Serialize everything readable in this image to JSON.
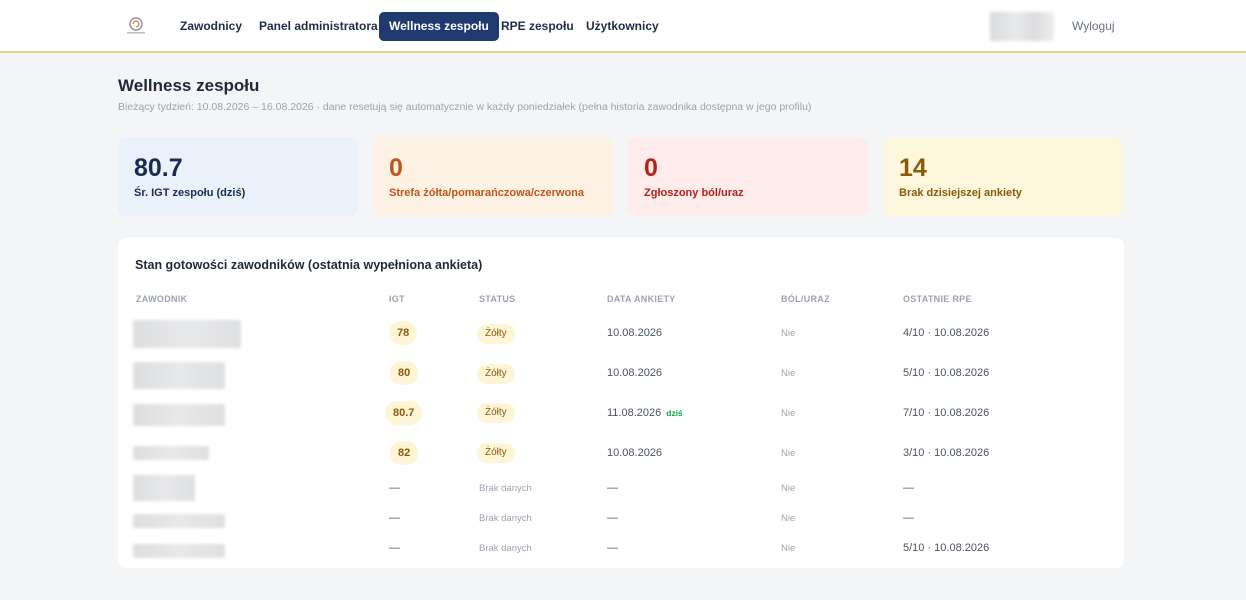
{
  "nav": {
    "items": [
      {
        "label": "Zawodnicy",
        "active": false
      },
      {
        "label": "Panel administratora",
        "active": false
      },
      {
        "label": "Wellness zespołu",
        "active": true
      },
      {
        "label": "RPE zespołu",
        "active": false
      },
      {
        "label": "Użytkownicy",
        "active": false
      }
    ],
    "logout_label": "Wyloguj"
  },
  "header": {
    "title": "Wellness zespołu",
    "subtitle": "Bieżący tydzień: 10.08.2026 – 16.08.2026 · dane resetują się automatycznie w każdy poniedziałek (pełna historia zawodnika dostępna w jego profilu)"
  },
  "stats": [
    {
      "value": "80.7",
      "label": "Śr. IGT zespołu (dziś)"
    },
    {
      "value": "0",
      "label": "Strefa żółta/pomarańczowa/czerwona"
    },
    {
      "value": "0",
      "label": "Zgłoszony ból/uraz"
    },
    {
      "value": "14",
      "label": "Brak dzisiejszej ankiety"
    }
  ],
  "table": {
    "title": "Stan gotowości zawodników (ostatnia wypełniona ankieta)",
    "columns": [
      "ZAWODNIK",
      "IGT",
      "STATUS",
      "DATA ANKIETY",
      "BÓL/URAZ",
      "OSTATNIE RPE"
    ],
    "today_label": "dziś",
    "rows": [
      {
        "igt": "78",
        "status": "Żółty",
        "date": "10.08.2026",
        "today": false,
        "pain": "Nie",
        "rpe": "4/10 · 10.08.2026"
      },
      {
        "igt": "80",
        "status": "Żółty",
        "date": "10.08.2026",
        "today": false,
        "pain": "Nie",
        "rpe": "5/10 · 10.08.2026"
      },
      {
        "igt": "80.7",
        "status": "Żółty",
        "date": "11.08.2026",
        "today": true,
        "pain": "Nie",
        "rpe": "7/10 · 10.08.2026"
      },
      {
        "igt": "82",
        "status": "Żółty",
        "date": "10.08.2026",
        "today": false,
        "pain": "Nie",
        "rpe": "3/10 · 10.08.2026"
      },
      {
        "igt": "—",
        "status": "Brak danych",
        "date": "—",
        "today": false,
        "pain": "Nie",
        "rpe": "—"
      },
      {
        "igt": "—",
        "status": "Brak danych",
        "date": "—",
        "today": false,
        "pain": "Nie",
        "rpe": "—"
      },
      {
        "igt": "—",
        "status": "Brak danych",
        "date": "—",
        "today": false,
        "pain": "Nie",
        "rpe": "5/10 · 10.08.2026"
      }
    ]
  },
  "colors": {
    "nav_active_bg": "#1e3a6e",
    "yellow_badge_bg": "#fdf5d6",
    "yellow_badge_text": "#8a5a0b",
    "today_green": "#16a34a"
  }
}
